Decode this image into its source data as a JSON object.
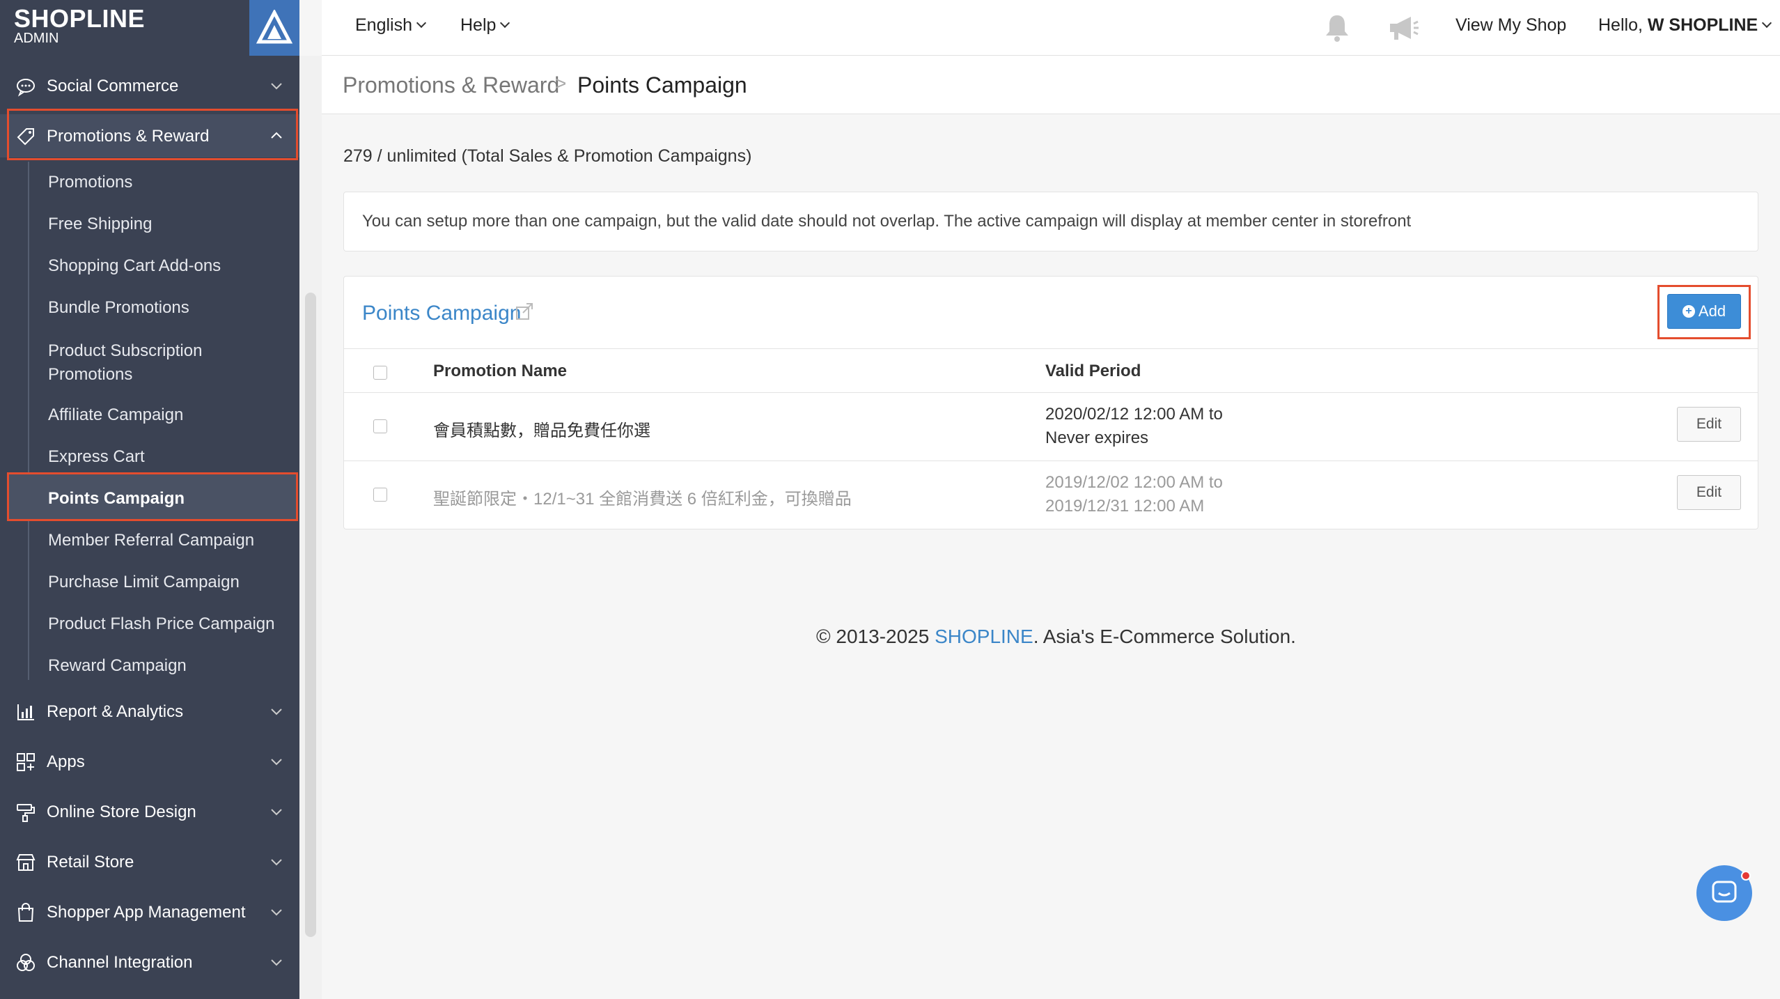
{
  "brand": {
    "logo": "SHOPLINE",
    "subtitle": "ADMIN"
  },
  "sidebar": {
    "items": [
      {
        "label": "Social Commerce",
        "icon": "chat-bubble-icon"
      },
      {
        "label": "Promotions & Reward",
        "icon": "tag-icon",
        "expanded": true
      },
      {
        "label": "Report & Analytics",
        "icon": "bar-chart-icon"
      },
      {
        "label": "Apps",
        "icon": "apps-grid-icon"
      },
      {
        "label": "Online Store Design",
        "icon": "paint-roller-icon"
      },
      {
        "label": "Retail Store",
        "icon": "store-icon"
      },
      {
        "label": "Shopper App Management",
        "icon": "shopping-bag-icon"
      },
      {
        "label": "Channel Integration",
        "icon": "channels-icon"
      }
    ],
    "sub_items": [
      "Promotions",
      "Free Shipping",
      "Shopping Cart Add-ons",
      "Bundle Promotions",
      "Product Subscription",
      "Promotions",
      "Affiliate Campaign",
      "Express Cart",
      "Points Campaign",
      "Member Referral Campaign",
      "Purchase Limit Campaign",
      "Product Flash Price Campaign",
      "Reward Campaign"
    ],
    "active_sub_item": "Points Campaign"
  },
  "topbar": {
    "language": "English",
    "help": "Help",
    "view_shop": "View My Shop",
    "greeting": "Hello,",
    "user": "W SHOPLINE"
  },
  "breadcrumb": {
    "parent": "Promotions & Reward",
    "separator": ">",
    "current": "Points Campaign"
  },
  "quota": "279 / unlimited (Total Sales & Promotion Campaigns)",
  "notice": "You can setup more than one campaign, but the valid date should not overlap. The active campaign will display at member center in storefront",
  "panel": {
    "title": "Points Campaign",
    "add_label": "Add",
    "columns": [
      "Promotion Name",
      "Valid Period"
    ],
    "rows": [
      {
        "name": "會員積點數，贈品免費任你選",
        "period_start": "2020/02/12 12:00 AM to",
        "period_end": "Never expires",
        "edit": "Edit",
        "active": true
      },
      {
        "name": "聖誕節限定・12/1~31 全館消費送 6 倍紅利金，可換贈品",
        "period_start": "2019/12/02 12:00 AM to",
        "period_end": "2019/12/31 12:00 AM",
        "edit": "Edit",
        "active": false
      }
    ]
  },
  "footer": {
    "prefix": "© 2013-2025 ",
    "brand": "SHOPLINE",
    "suffix": ". Asia's E-Commerce Solution."
  },
  "colors": {
    "sidebar_bg": "#3b4253",
    "accent": "#3d8dd7",
    "highlight": "#e44d2e",
    "link": "#3b86c8"
  }
}
